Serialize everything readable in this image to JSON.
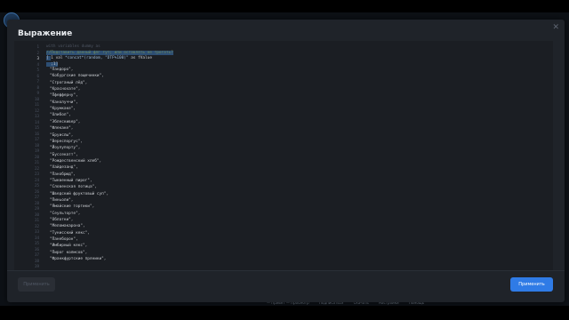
{
  "dialog": {
    "title": "Выражение",
    "apply_disabled_label": "Применить",
    "apply_label": "Применить"
  },
  "background": {
    "footer_items": [
      "— Привет — Просмотр",
      "Подписаться",
      "Скачать",
      "Настройки",
      "Помощь"
    ]
  },
  "editor": {
    "line_numbers": [
      "1",
      "2",
      "3",
      "4",
      "5",
      "6",
      "7",
      "8",
      "9",
      "10",
      "11",
      "12",
      "13",
      "14",
      "15",
      "16",
      "17",
      "18",
      "19",
      "20",
      "21",
      "22",
      "23",
      "24",
      "25",
      "26",
      "27",
      "28",
      "29",
      "30",
      "31",
      "32",
      "33",
      "34",
      "35",
      "36",
      "37",
      "38",
      "39"
    ],
    "active_line": "3",
    "line1": "with variables dummy as",
    "line2": "//Подставить данный флг тут; или оставлять не трогать?",
    "line3_a": "[ ",
    "line3_b": "1 val ",
    "line3_c": "*concat*(random, \"DTF%100)\"",
    "line3_d": " as fValue",
    "line4": "  ;1]",
    "items": [
      "\"Пандоро\",",
      "\"Кобургские пощечинки\",",
      "\"Строганый лёд\",",
      "\"Краснохате\",",
      "\"Пфефферну\",",
      "\"Канолуччи\",",
      "\"Крумкаке\",",
      "\"Олибол\",",
      "\"Эблескивер\",",
      "\"Флекаке\",",
      "\"Бруислы\",",
      "\"Вереспоргус\",",
      "\"Йоулупорту\",",
      "\"Буссекатт\",",
      "\"Рождественский хлеб\",",
      "\"Хайдезанд\",",
      "\"Панобрюд\",",
      "\"Тыквенный пирог\",",
      "\"Словенская потица\",",
      "\"Шведский фруктовый суп\",",
      "\"Пиньоли\",",
      "\"Ямайские тортики\",",
      "\"Сеульторте\",",
      "\"Облатки\",",
      "\"Меломакарона\",",
      "\"Тунисский кекс\",",
      "\"Панеборон\",",
      "\"Имбирный кекс\",",
      "\"Пирог колмсов\",",
      "\"Франкфуртские пряники\","
    ]
  }
}
